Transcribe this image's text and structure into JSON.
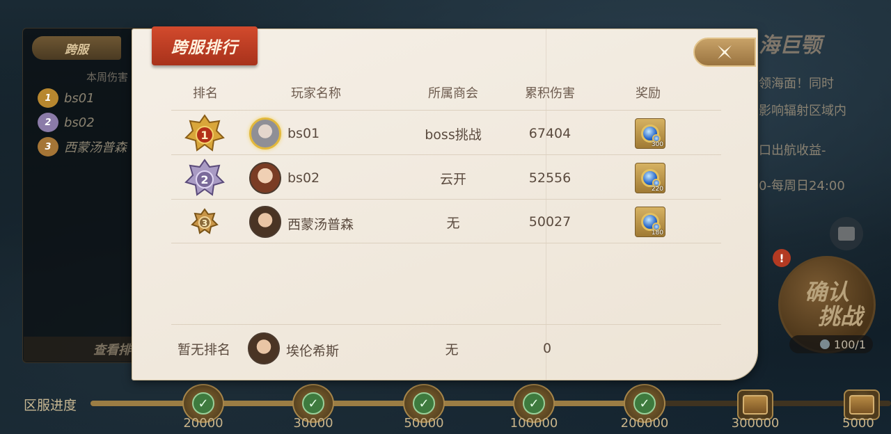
{
  "background": {
    "left_panel": {
      "tab_label": "跨服",
      "subtitle": "本周伤害",
      "rows": [
        {
          "rank": "1",
          "name": "bs01",
          "color": "#b7872f"
        },
        {
          "rank": "2",
          "name": "bs02",
          "color": "#8b7ba8"
        },
        {
          "rank": "3",
          "name": "西蒙汤普森",
          "color": "#a57536"
        }
      ],
      "view_button": "查看排"
    },
    "right_panel": {
      "title": "海巨颚",
      "lines": [
        "领海面！同时",
        "影响辐射区域内",
        "口出航收益-",
        "0-每周日24:00"
      ]
    },
    "alert_badge": "!",
    "confirm_button": {
      "line1": "确认",
      "line2": "挑战"
    },
    "ticket": "100/1"
  },
  "progress": {
    "label": "区服进度",
    "fill_fraction": 0.71,
    "milestones": [
      {
        "value": "20000",
        "done": true
      },
      {
        "value": "30000",
        "done": true
      },
      {
        "value": "50000",
        "done": true
      },
      {
        "value": "100000",
        "done": true
      },
      {
        "value": "200000",
        "done": true
      },
      {
        "value": "300000",
        "done": false
      },
      {
        "value": "5000",
        "done": false
      }
    ]
  },
  "modal": {
    "title": "跨服排行",
    "close_icon": "close-x-icon",
    "headers": {
      "rank": "排名",
      "player": "玩家名称",
      "guild": "所属商会",
      "damage": "累积伤害",
      "reward": "奖励"
    },
    "rows": [
      {
        "rank": "1",
        "medal_color": "#c48a2a",
        "player": "bs01",
        "guild": "boss挑战",
        "damage": "67404",
        "reward_count": "300"
      },
      {
        "rank": "2",
        "medal_color": "#8c7aab",
        "player": "bs02",
        "guild": "云开",
        "damage": "52556",
        "reward_count": "220"
      },
      {
        "rank": "3",
        "medal_color": "#b0843a",
        "player": "西蒙汤普森",
        "guild": "无",
        "damage": "50027",
        "reward_count": "180"
      }
    ],
    "self_row": {
      "rank": "暂无排名",
      "player": "埃伦希斯",
      "guild": "无",
      "damage": "0"
    }
  }
}
